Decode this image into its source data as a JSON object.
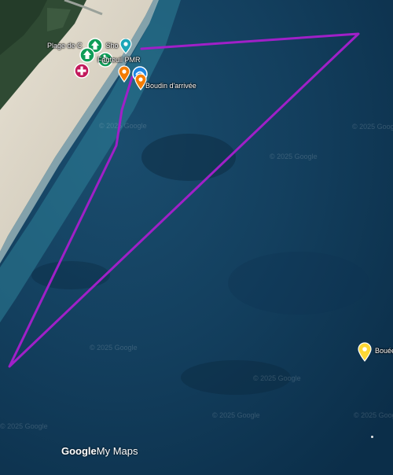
{
  "map": {
    "markers": [
      {
        "label": "Plage de C",
        "label_suffix": "Sho",
        "icon": "beach-marker-icon",
        "color": "#0f9d58"
      },
      {
        "label": "Fauteuil PMR",
        "icon": "wheelchair-marker-icon",
        "color": "#0f9d58"
      },
      {
        "label": "",
        "icon": "first-aid-marker-icon",
        "color": "#c2185b"
      },
      {
        "label": "",
        "icon": "orange-pin-icon",
        "color": "#f57c00"
      },
      {
        "label": "Boudin d'arrivée",
        "icon": "orange-pin-icon",
        "color": "#f57c00"
      },
      {
        "label": "Bouée",
        "icon": "yellow-pin-icon",
        "color": "#fdd835"
      }
    ],
    "route": {
      "color": "#a020c8"
    },
    "watermark": "© 2025 Google",
    "branding": {
      "google": "Google",
      "product": "My Maps"
    }
  }
}
